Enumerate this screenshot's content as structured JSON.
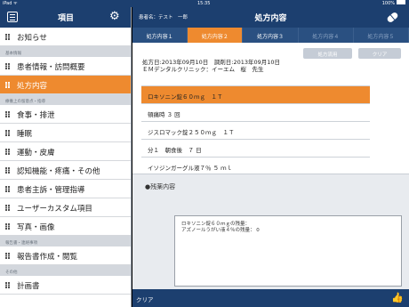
{
  "statusbar": {
    "carrier": "iPad ᯤ",
    "time": "15:35",
    "battery": "100%"
  },
  "sidebar": {
    "title": "項目",
    "sections": [
      {
        "header": "",
        "items": [
          {
            "label": "お知らせ",
            "active": false
          }
        ]
      },
      {
        "header": "基本情報",
        "items": [
          {
            "label": "患者情報・訪問概要",
            "active": false
          },
          {
            "label": "処方内容",
            "active": true
          }
        ]
      },
      {
        "header": "療養上の留意点・指導",
        "items": [
          {
            "label": "食事・排泄",
            "active": false
          },
          {
            "label": "睡眠",
            "active": false
          },
          {
            "label": "運動・皮膚",
            "active": false
          },
          {
            "label": "認知機能・疼痛・その他",
            "active": false
          },
          {
            "label": "患者主訴・管理指導",
            "active": false
          },
          {
            "label": "ユーザーカスタム項目",
            "active": false
          },
          {
            "label": "写真・画像",
            "active": false
          }
        ]
      },
      {
        "header": "報告書・連絡事項",
        "items": [
          {
            "label": "報告書作成・閲覧",
            "active": false
          }
        ]
      },
      {
        "header": "その他",
        "items": [
          {
            "label": "計画書",
            "active": false
          }
        ]
      }
    ]
  },
  "main": {
    "patient": "患者名：テスト　一郎",
    "title": "処方内容",
    "tabs": [
      {
        "label": "処方内容１",
        "state": "normal"
      },
      {
        "label": "処方内容２",
        "state": "active"
      },
      {
        "label": "処方内容３",
        "state": "normal"
      },
      {
        "label": "処方内容４",
        "state": "disabled"
      },
      {
        "label": "処方内容５",
        "state": "disabled"
      }
    ],
    "copy_button": "処方流用",
    "clear_button": "クリア",
    "rx_info_line1": "処方日:2013年09月10日　調剤日:2013年09月10日",
    "rx_info_line2": "ＥＭデンタルクリニック：イーエム　桜　先生",
    "rx_rows": [
      {
        "text": "ロキソニン錠６０ｍｇ　１Ｔ",
        "selected": true
      },
      {
        "text": "頓痛時 ３ 回",
        "selected": false
      },
      {
        "text": "ジスロマック錠２５０ｍｇ　１Ｔ",
        "selected": false
      },
      {
        "text": "分１　朝食後　７ 日",
        "selected": false
      },
      {
        "text": "イソジンガーグル液７％ ５ ｍｌ",
        "selected": false
      }
    ],
    "remain_label": "●残薬内容",
    "remain_text": "ロキソニン錠６０ｍｇの残量：\nアズノールうがい液４％の残量： 0"
  },
  "footer": {
    "clear_label": "クリア",
    "thumb_icon": "thumbs-up-icon"
  },
  "colors": {
    "navy": "#1c3f6f",
    "accent": "#ee8a2f"
  }
}
